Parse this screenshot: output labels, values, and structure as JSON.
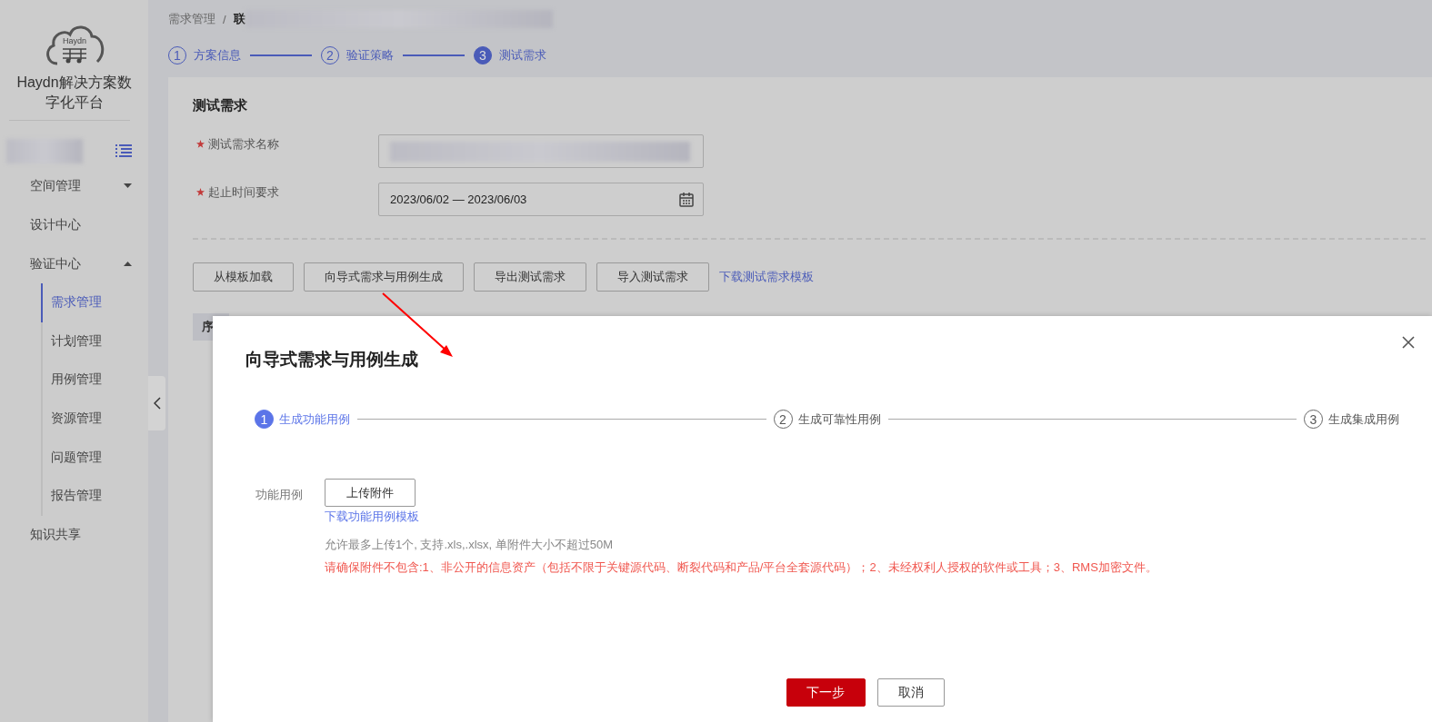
{
  "sidebar": {
    "logo_text": "Haydn",
    "title": "Haydn解决方案数字化平台",
    "items": [
      {
        "label": "空间管理",
        "expanded": false
      },
      {
        "label": "设计中心"
      },
      {
        "label": "验证中心",
        "expanded": true,
        "children": [
          {
            "label": "需求管理",
            "selected": true
          },
          {
            "label": "计划管理",
            "selected": false
          },
          {
            "label": "用例管理",
            "selected": false
          },
          {
            "label": "资源管理",
            "selected": false
          },
          {
            "label": "问题管理",
            "selected": false
          },
          {
            "label": "报告管理",
            "selected": false
          }
        ]
      },
      {
        "label": "知识共享"
      }
    ]
  },
  "breadcrumb": {
    "items": [
      "需求管理",
      "联"
    ],
    "separator": "/"
  },
  "steps": [
    {
      "number": "1",
      "label": "方案信息",
      "selected": false
    },
    {
      "number": "2",
      "label": "验证策略",
      "selected": false
    },
    {
      "number": "3",
      "label": "测试需求",
      "selected": true
    }
  ],
  "form": {
    "title": "测试需求",
    "fields": [
      {
        "label": "测试需求名称",
        "required": true,
        "kind": "text"
      },
      {
        "label": "起止时间要求",
        "required": true,
        "kind": "date",
        "value": "2023/06/02 — 2023/06/03"
      }
    ],
    "buttons": [
      "从模板加载",
      "向导式需求与用例生成",
      "导出测试需求",
      "导入测试需求"
    ],
    "link": "下载测试需求模板",
    "table_header": "序"
  },
  "dialog": {
    "title": "向导式需求与用例生成",
    "steps": [
      {
        "number": "1",
        "label": "生成功能用例",
        "selected": true
      },
      {
        "number": "2",
        "label": "生成可靠性用例",
        "selected": false
      },
      {
        "number": "3",
        "label": "生成集成用例",
        "selected": false
      }
    ],
    "field_label": "功能用例",
    "upload_button": "上传附件",
    "template_link": "下载功能用例模板",
    "hint": "允许最多上传1个, 支持.xls,.xlsx, 单附件大小不超过50M",
    "warning": "请确保附件不包含:1、非公开的信息资产（包括不限于关键源代码、断裂代码和产品/平台全套源代码）；2、未经权利人授权的软件或工具；3、RMS加密文件。",
    "buttons": [
      {
        "label": "下一步",
        "kind": "primary"
      },
      {
        "label": "取消",
        "kind": "secondary"
      }
    ]
  }
}
